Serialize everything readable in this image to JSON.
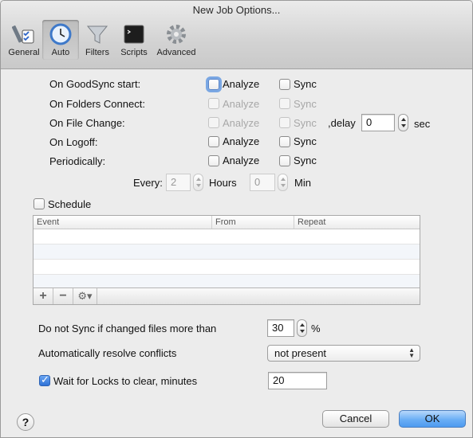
{
  "window": {
    "title": "New Job Options..."
  },
  "toolbar": {
    "tabs": [
      {
        "label": "General",
        "icon": "tools-icon"
      },
      {
        "label": "Auto",
        "icon": "clock-icon",
        "selected": true
      },
      {
        "label": "Filters",
        "icon": "funnel-icon"
      },
      {
        "label": "Scripts",
        "icon": "terminal-icon"
      },
      {
        "label": "Advanced",
        "icon": "gear-icon"
      }
    ]
  },
  "triggers": {
    "analyze_label": "Analyze",
    "sync_label": "Sync",
    "rows": [
      {
        "label": "On GoodSync start:",
        "analyze": false,
        "sync": false,
        "enabled": true
      },
      {
        "label": "On Folders Connect:",
        "analyze": false,
        "sync": false,
        "enabled": false
      },
      {
        "label": "On File Change:",
        "analyze": false,
        "sync": false,
        "enabled": false
      },
      {
        "label": "On Logoff:",
        "analyze": false,
        "sync": false,
        "enabled": true
      },
      {
        "label": "Periodically:",
        "analyze": false,
        "sync": false,
        "enabled": true
      }
    ],
    "delay_label": ",delay",
    "delay_value": "0",
    "delay_unit": "sec",
    "every_label": "Every:",
    "hours_value": "2",
    "hours_label": "Hours",
    "min_value": "0",
    "min_label": "Min"
  },
  "schedule": {
    "label": "Schedule",
    "checked": false,
    "columns": [
      "Event",
      "From",
      "Repeat"
    ],
    "add": "+",
    "remove": "−",
    "gear": "⚙▾"
  },
  "options": {
    "max_changes_label": "Do not Sync if changed files more than",
    "max_changes_value": "30",
    "max_changes_unit": "%",
    "conflicts_label": "Automatically resolve conflicts",
    "conflicts_value": "not present",
    "locks_label": "Wait for Locks to clear, minutes",
    "locks_checked": true,
    "locks_value": "20"
  },
  "footer": {
    "help": "?",
    "cancel": "Cancel",
    "ok": "OK"
  },
  "colors": {
    "accent": "#4d9bf0",
    "disabled_text": "#a8a8a8"
  }
}
